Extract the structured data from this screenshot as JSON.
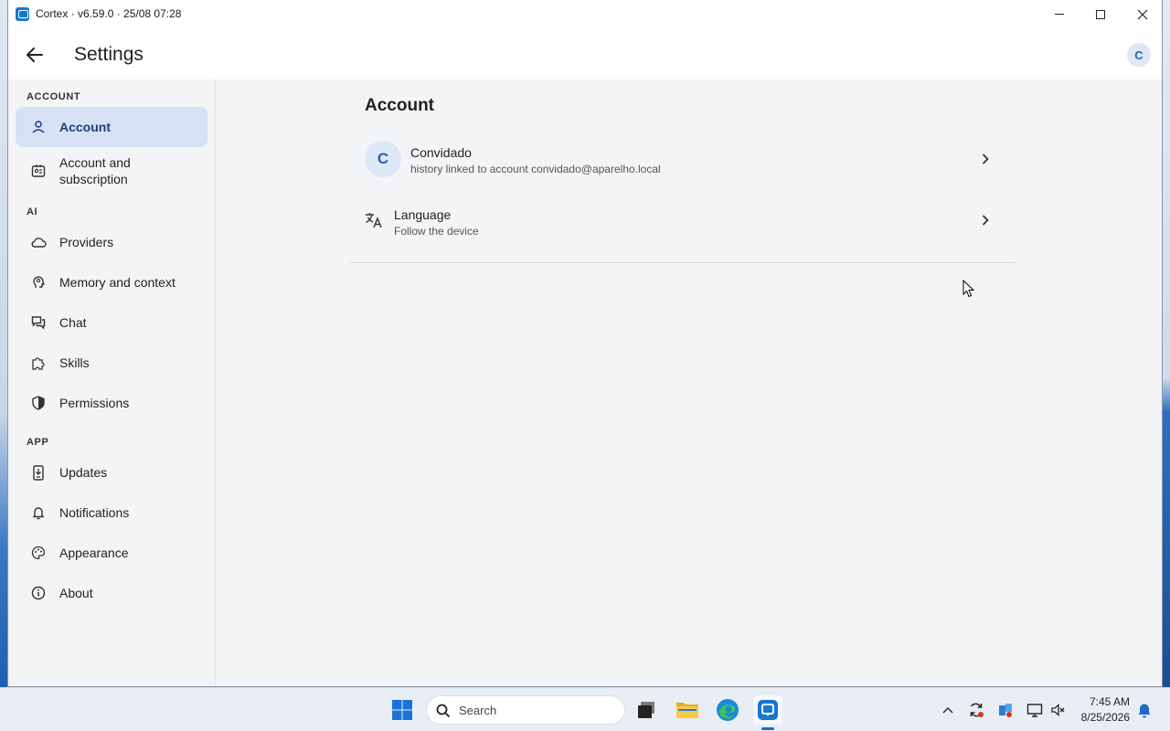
{
  "window": {
    "title": "Cortex · v6.59.0 · 25/08 07:28"
  },
  "header": {
    "title": "Settings",
    "avatar_initial": "C"
  },
  "sidebar": {
    "sections": {
      "account": "ACCOUNT",
      "ai": "AI",
      "app": "APP"
    },
    "items": [
      {
        "label": "Account",
        "icon": "person-icon",
        "active": true
      },
      {
        "label": "Account and subscription",
        "icon": "id-badge-icon"
      },
      {
        "label": "Providers",
        "icon": "cloud-icon"
      },
      {
        "label": "Memory and context",
        "icon": "brain-icon"
      },
      {
        "label": "Chat",
        "icon": "chat-bubbles-icon"
      },
      {
        "label": "Skills",
        "icon": "puzzle-icon"
      },
      {
        "label": "Permissions",
        "icon": "shield-icon"
      },
      {
        "label": "Updates",
        "icon": "download-phone-icon"
      },
      {
        "label": "Notifications",
        "icon": "bell-icon"
      },
      {
        "label": "Appearance",
        "icon": "palette-icon"
      },
      {
        "label": "About",
        "icon": "info-icon"
      }
    ]
  },
  "main": {
    "title": "Account",
    "profile": {
      "initial": "C",
      "name": "Convidado",
      "subtitle": "history linked to account convidado@aparelho.local"
    },
    "language": {
      "title": "Language",
      "subtitle": "Follow the device",
      "icon": "translate-icon"
    }
  },
  "taskbar": {
    "search_placeholder": "Search",
    "time": "7:45 AM",
    "date": "8/25/2026"
  },
  "colors": {
    "accent": "#1b6ac9",
    "active_nav_bg": "#d7e1f5",
    "sidebar_bg": "#f3f4f6"
  }
}
